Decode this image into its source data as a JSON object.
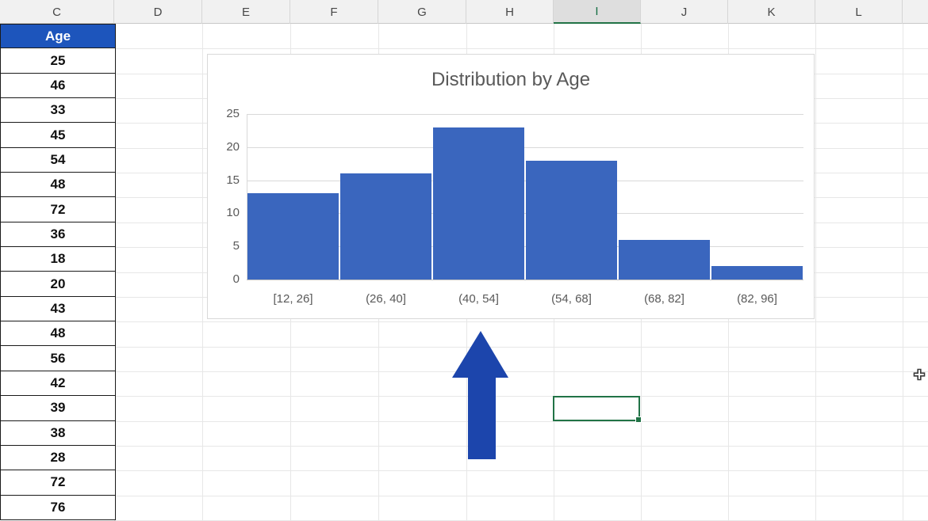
{
  "sheet": {
    "column_headers": [
      "C",
      "D",
      "E",
      "F",
      "G",
      "H",
      "I",
      "J",
      "K",
      "L"
    ],
    "selected_column": "I",
    "age_table": {
      "header": "Age",
      "values": [
        25,
        46,
        33,
        45,
        54,
        48,
        72,
        36,
        18,
        20,
        43,
        48,
        56,
        42,
        39,
        38,
        28,
        72,
        76
      ]
    },
    "selected_cell": {
      "column": "I",
      "value": ""
    }
  },
  "chart_data": {
    "type": "bar",
    "chart_kind": "histogram",
    "title": "Distribution by Age",
    "categories": [
      "[12, 26]",
      "(26, 40]",
      "(40, 54]",
      "(54, 68]",
      "(68, 82]",
      "(82, 96]"
    ],
    "values": [
      13,
      16,
      23,
      18,
      6,
      2
    ],
    "xlabel": "",
    "ylabel": "",
    "yticks": [
      0,
      5,
      10,
      15,
      20,
      25
    ],
    "ylim": [
      0,
      25
    ],
    "grid": true,
    "legend_position": "none",
    "bar_color": "#3A66BE"
  },
  "icons": {
    "arrow_shape": "block-arrow-up",
    "cursor": "move-cursor"
  },
  "colors": {
    "age_header_bg": "#1D55BC",
    "age_header_text": "#FFFFFF",
    "bar_fill": "#3A66BE",
    "arrow_fill": "#1C45AC",
    "selection_green": "#217346",
    "chart_text": "#595959",
    "header_bg": "#F1F1F1",
    "header_selected_bg": "#DEDEDE",
    "gridline": "#E7E7E7"
  }
}
